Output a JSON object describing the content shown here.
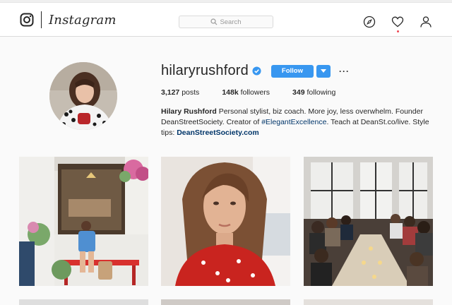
{
  "nav": {
    "brand": "Instagram",
    "search_placeholder": "Search",
    "icons": [
      "instagram-camera-icon",
      "compass-icon",
      "heart-icon",
      "user-icon"
    ]
  },
  "profile": {
    "username": "hilaryrushford",
    "follow_label": "Follow",
    "more_label": "···",
    "posts_count": "3,127",
    "posts_label": "posts",
    "followers_count": "148k",
    "followers_label": "followers",
    "following_count": "349",
    "following_label": "following",
    "full_name": "Hilary Rushford",
    "bio_part1": "Personal stylist, biz coach. More joy, less overwhelm. Founder DeanStreetSociety. Creator of",
    "bio_hashtag": "#ElegantExcellence",
    "bio_part2": ". Teach at DeanSt.co/live. Style tips:",
    "bio_link": "DeanStreetSociety.com"
  },
  "colors": {
    "accent": "#3897f0",
    "link": "#003569",
    "notification": "#ed4956"
  }
}
